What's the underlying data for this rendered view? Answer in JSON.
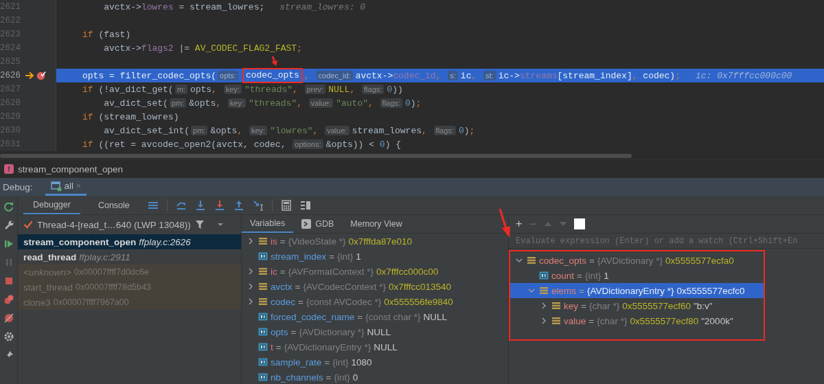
{
  "code_lines": [
    {
      "number": "2621",
      "current": false,
      "breakpoint": false,
      "tokens": [
        {
          "text": "    avctx->",
          "kind": "txt"
        },
        {
          "text": "lowres",
          "kind": "field"
        },
        {
          "text": " = stream_lowres;",
          "kind": "txt"
        },
        {
          "text": "stream_lowres: 0",
          "kind": "inline"
        }
      ]
    },
    {
      "number": "2622",
      "current": false,
      "breakpoint": false
    },
    {
      "number": "2623",
      "current": false,
      "breakpoint": false,
      "tokens": [
        {
          "text": "if",
          "kind": "kw"
        },
        {
          "text": " (fast)",
          "kind": "txt"
        }
      ]
    },
    {
      "number": "2624",
      "current": false,
      "breakpoint": false,
      "tokens": [
        {
          "text": "    avctx->",
          "kind": "txt"
        },
        {
          "text": "flags2",
          "kind": "field"
        },
        {
          "text": " |= ",
          "kind": "txt"
        },
        {
          "text": "AV_CODEC_FLAG2_FAST",
          "kind": "macro"
        },
        {
          "text": ";",
          "kind": "punct"
        }
      ]
    },
    {
      "number": "2625",
      "current": false,
      "breakpoint": false
    },
    {
      "number": "2626",
      "current": true,
      "breakpoint": true,
      "tokens": [
        {
          "text": "opts = filter_codec_opts(",
          "kind": "txt"
        },
        {
          "text": "opts:",
          "kind": "hint"
        },
        {
          "text": "codec_opts",
          "kind": "txt",
          "boxed": true
        },
        {
          "text": ", ",
          "kind": "punct"
        },
        {
          "text": "codec_id:",
          "kind": "hint"
        },
        {
          "text": "avctx->",
          "kind": "txt"
        },
        {
          "text": "codec_id",
          "kind": "field"
        },
        {
          "text": ", ",
          "kind": "punct"
        },
        {
          "text": "s:",
          "kind": "hint"
        },
        {
          "text": "ic",
          "kind": "txt"
        },
        {
          "text": ", ",
          "kind": "punct"
        },
        {
          "text": "st:",
          "kind": "hint"
        },
        {
          "text": "ic->",
          "kind": "txt"
        },
        {
          "text": "streams",
          "kind": "field"
        },
        {
          "text": "[stream_index]",
          "kind": "txt"
        },
        {
          "text": ",",
          "kind": "punct"
        },
        {
          "text": " codec)",
          "kind": "txt"
        },
        {
          "text": ";",
          "kind": "punct"
        },
        {
          "text": "ic: 0x7fffcc000c00",
          "kind": "inline"
        }
      ]
    },
    {
      "number": "2627",
      "current": false,
      "breakpoint": false,
      "tokens": [
        {
          "text": "if",
          "kind": "kw"
        },
        {
          "text": " (!av_dict_get(",
          "kind": "txt"
        },
        {
          "text": "m:",
          "kind": "hint"
        },
        {
          "text": "opts",
          "kind": "txt"
        },
        {
          "text": ", ",
          "kind": "punct"
        },
        {
          "text": "key:",
          "kind": "hint"
        },
        {
          "text": "\"threads\"",
          "kind": "str"
        },
        {
          "text": ", ",
          "kind": "punct"
        },
        {
          "text": "prev:",
          "kind": "hint"
        },
        {
          "text": "NULL",
          "kind": "macro"
        },
        {
          "text": ", ",
          "kind": "punct"
        },
        {
          "text": "flags:",
          "kind": "hint"
        },
        {
          "text": "0",
          "kind": "num"
        },
        {
          "text": "))",
          "kind": "txt"
        }
      ]
    },
    {
      "number": "2628",
      "current": false,
      "breakpoint": false,
      "tokens": [
        {
          "text": "    av_dict_set(",
          "kind": "txt"
        },
        {
          "text": "pm:",
          "kind": "hint"
        },
        {
          "text": "&opts",
          "kind": "txt"
        },
        {
          "text": ", ",
          "kind": "punct"
        },
        {
          "text": "key:",
          "kind": "hint"
        },
        {
          "text": "\"threads\"",
          "kind": "str"
        },
        {
          "text": ", ",
          "kind": "punct"
        },
        {
          "text": "value:",
          "kind": "hint"
        },
        {
          "text": "\"auto\"",
          "kind": "str"
        },
        {
          "text": ", ",
          "kind": "punct"
        },
        {
          "text": "flags:",
          "kind": "hint"
        },
        {
          "text": "0",
          "kind": "num"
        },
        {
          "text": ")",
          "kind": "txt"
        },
        {
          "text": ";",
          "kind": "punct"
        }
      ]
    },
    {
      "number": "2629",
      "current": false,
      "breakpoint": false,
      "tokens": [
        {
          "text": "if",
          "kind": "kw"
        },
        {
          "text": " (stream_lowres)",
          "kind": "txt"
        }
      ]
    },
    {
      "number": "2630",
      "current": false,
      "breakpoint": false,
      "tokens": [
        {
          "text": "    av_dict_set_int(",
          "kind": "txt"
        },
        {
          "text": "pm:",
          "kind": "hint"
        },
        {
          "text": "&opts",
          "kind": "txt"
        },
        {
          "text": ", ",
          "kind": "punct"
        },
        {
          "text": "key:",
          "kind": "hint"
        },
        {
          "text": "\"lowres\"",
          "kind": "str"
        },
        {
          "text": ", ",
          "kind": "punct"
        },
        {
          "text": "value:",
          "kind": "hint"
        },
        {
          "text": "stream_lowres",
          "kind": "txt"
        },
        {
          "text": ", ",
          "kind": "punct"
        },
        {
          "text": "flags:",
          "kind": "hint"
        },
        {
          "text": "0",
          "kind": "num"
        },
        {
          "text": ")",
          "kind": "txt"
        },
        {
          "text": ";",
          "kind": "punct"
        }
      ]
    },
    {
      "number": "2631",
      "current": false,
      "breakpoint": false,
      "tokens": [
        {
          "text": "if",
          "kind": "kw"
        },
        {
          "text": " ((ret = avcodec_open2(avctx, codec, ",
          "kind": "txt"
        },
        {
          "text": "options:",
          "kind": "hint"
        },
        {
          "text": "&opts)) < ",
          "kind": "txt"
        },
        {
          "text": "0",
          "kind": "num"
        },
        {
          "text": ") {",
          "kind": "txt"
        }
      ]
    }
  ],
  "breadcrumb": {
    "badge": "f",
    "function": "stream_component_open"
  },
  "debug_bar": {
    "label": "Debug:",
    "tabs": [
      {
        "label": "all",
        "close": "×",
        "selected": true
      }
    ]
  },
  "toolbar": {
    "tabs": [
      {
        "label": "Debugger",
        "selected": true
      },
      {
        "label": "Console",
        "selected": false
      }
    ]
  },
  "thread": {
    "label": "Thread-4-[read_t…640 (LWP 13048))"
  },
  "frames": [
    {
      "name": "stream_component_open",
      "location": "ffplay.c:2626",
      "kind": "source",
      "selected": true
    },
    {
      "name": "read_thread",
      "location": "ffplay.c:2911",
      "kind": "source",
      "selected": false
    },
    {
      "name": "<unknown>",
      "location": "0x00007ffff7d0dc6e",
      "kind": "unknown",
      "selected": false
    },
    {
      "name": "start_thread",
      "location": "0x00007ffff78d5b43",
      "kind": "external",
      "selected": false
    },
    {
      "name": "clone3",
      "location": "0x00007ffff7967a00",
      "kind": "external",
      "selected": false
    }
  ],
  "variables_tabs": [
    {
      "label": "Variables",
      "selected": true,
      "kind": "plain"
    },
    {
      "label": "GDB",
      "selected": false,
      "kind": "console"
    },
    {
      "label": "Memory View",
      "selected": false,
      "kind": "plain"
    }
  ],
  "variables": [
    {
      "name": "is",
      "sep": "=",
      "type": "{VideoState *}",
      "value": "0x7fffda87e010",
      "kind": "pointer",
      "expanded": false,
      "color": "#e0707a"
    },
    {
      "name": "stream_index",
      "sep": "=",
      "type": "{int}",
      "value": "1",
      "kind": "scalar",
      "color": "#5c9de0"
    },
    {
      "name": "ic",
      "sep": "=",
      "type": "{AVFormatContext *}",
      "value": "0x7fffcc000c00",
      "kind": "pointer",
      "expanded": false,
      "color": "#e0707a"
    },
    {
      "name": "avctx",
      "sep": "=",
      "type": "{AVCodecContext *}",
      "value": "0x7fffcc013540",
      "kind": "pointer",
      "expanded": false,
      "color": "#5c9de0"
    },
    {
      "name": "codec",
      "sep": "=",
      "type": "{const AVCodec *}",
      "value": "0x555556fe9840",
      "kind": "pointer",
      "expanded": false,
      "color": "#5c9de0"
    },
    {
      "name": "forced_codec_name",
      "sep": "=",
      "type": "{const char *}",
      "value": "NULL",
      "kind": "scalar",
      "color": "#5c9de0"
    },
    {
      "name": "opts",
      "sep": "=",
      "type": "{AVDictionary *}",
      "value": "NULL",
      "kind": "scalar",
      "color": "#5c9de0"
    },
    {
      "name": "t",
      "sep": "=",
      "type": "{AVDictionaryEntry *}",
      "value": "NULL",
      "kind": "scalar",
      "color": "#e0707a"
    },
    {
      "name": "sample_rate",
      "sep": "=",
      "type": "{int}",
      "value": "1080",
      "kind": "scalar",
      "color": "#5c9de0"
    },
    {
      "name": "nb_channels",
      "sep": "=",
      "type": "{int}",
      "value": "0",
      "kind": "scalar",
      "color": "#5c9de0"
    }
  ],
  "watches": {
    "add": "+",
    "placeholder": "Evaluate expression (Enter) or add a watch (Ctrl+Shift+En",
    "boxed": true,
    "items": [
      {
        "name": "codec_opts",
        "sep": "=",
        "type": "{AVDictionary *}",
        "value": "0x5555577ecfa0",
        "kind": "pointer",
        "expanded": true,
        "selected": false,
        "color": "#e0807a",
        "children": [
          {
            "name": "count",
            "sep": "=",
            "type": "{int}",
            "value": "1",
            "kind": "scalar",
            "selected": false,
            "color": "#e0807a"
          },
          {
            "name": "elems",
            "sep": "=",
            "type": "{AVDictionaryEntry *}",
            "value": "0x5555577ecfc0",
            "kind": "pointer",
            "expanded": true,
            "selected": true,
            "color": "#e0807a",
            "children": [
              {
                "name": "key",
                "sep": "=",
                "type": "{char *}",
                "value": "0x5555577ecf60",
                "extra": "\"b:v\"",
                "kind": "pointer",
                "expanded": false,
                "selected": false,
                "color": "#e0807a"
              },
              {
                "name": "value",
                "sep": "=",
                "type": "{char *}",
                "value": "0x5555577ecf80",
                "extra": "\"2000k\"",
                "kind": "pointer",
                "expanded": false,
                "selected": false,
                "color": "#e0807a"
              }
            ]
          }
        ]
      }
    ]
  }
}
